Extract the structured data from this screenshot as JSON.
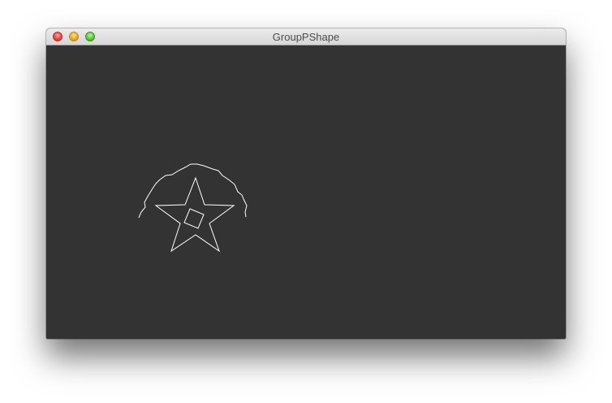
{
  "window": {
    "title": "GroupPShape",
    "buttons": {
      "close": "close",
      "minimize": "minimize",
      "zoom": "zoom"
    }
  },
  "sketch": {
    "background": "#333333",
    "stroke": "#ffffff",
    "shapes": [
      "wavy-arc",
      "star",
      "square"
    ]
  }
}
